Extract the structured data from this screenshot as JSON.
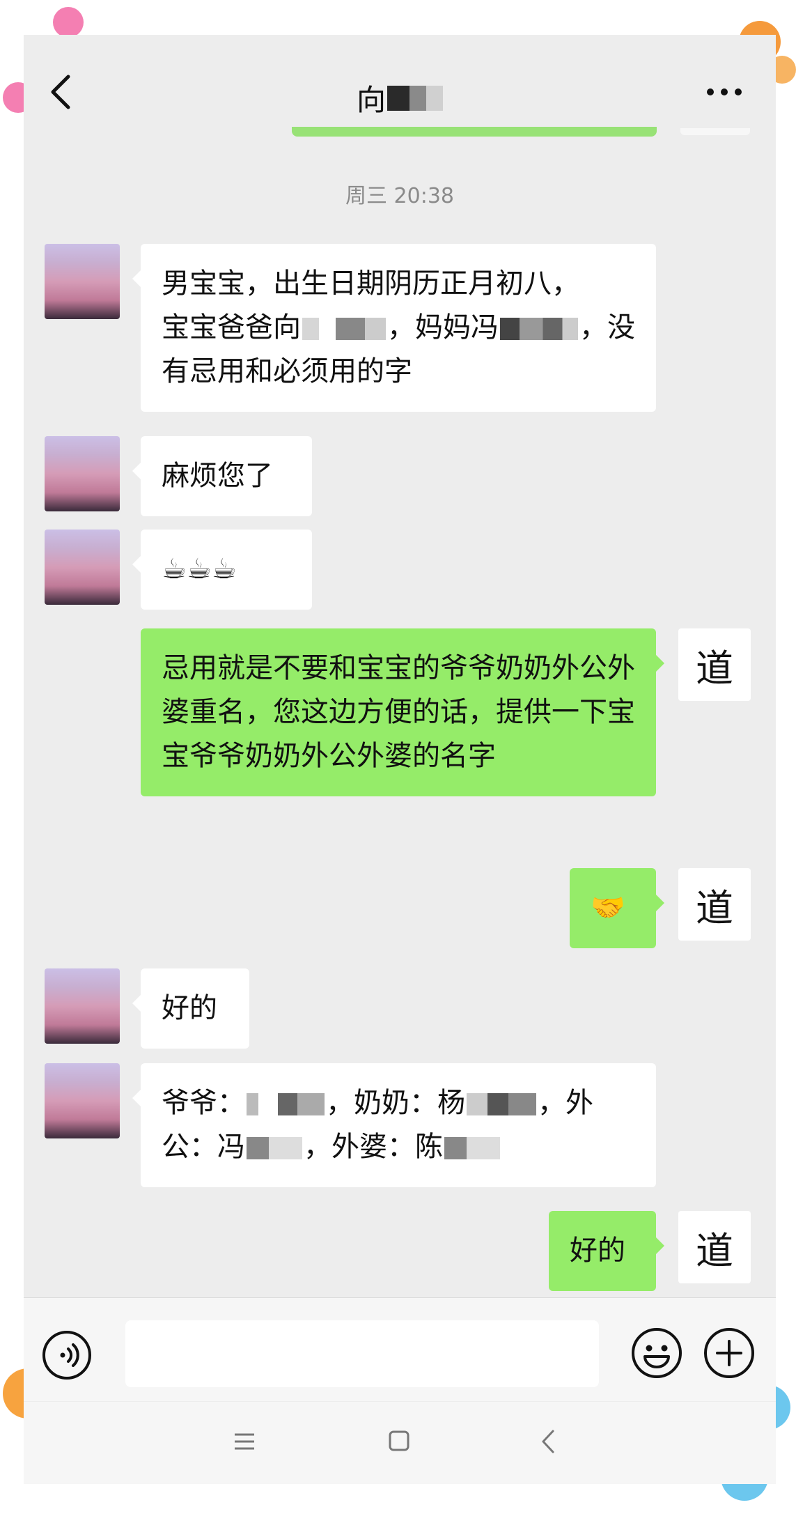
{
  "header": {
    "contact_name": "向"
  },
  "timestamp": "周三 20:38",
  "messages": [
    {
      "side": "in",
      "parts": [
        "男宝宝，出生日期阴历正月初八，",
        "宝宝爸爸向",
        "，妈妈冯",
        "，没有忌用和必须用的字"
      ]
    },
    {
      "side": "in",
      "text": "麻烦您了"
    },
    {
      "side": "in",
      "text": "☕☕☕"
    },
    {
      "side": "out",
      "text": "忌用就是不要和宝宝的爷爷奶奶外公外婆重名，您这边方便的话，提供一下宝宝爷爷奶奶外公外婆的名字"
    },
    {
      "side": "out",
      "text": "🤝"
    },
    {
      "side": "in",
      "text": "好的"
    },
    {
      "side": "in",
      "parts": [
        "爷爷：",
        "，奶奶：杨",
        "，外公：冯",
        "，外婆：陈"
      ]
    },
    {
      "side": "out",
      "text": "好的"
    }
  ],
  "my_avatar_glyph": "道",
  "input": {
    "placeholder": ""
  },
  "icons": {
    "back": "chevron-left-icon",
    "more": "more-dots-icon",
    "voice": "voice-icon",
    "emoji": "emoji-icon",
    "plus": "plus-icon",
    "nav_menu": "menu-icon",
    "nav_home": "home-icon",
    "nav_back": "back-icon"
  },
  "colors": {
    "chat_background": "#ededed",
    "incoming_bubble": "#ffffff",
    "outgoing_bubble": "#95ec69",
    "timestamp_text": "#8a8a8a"
  }
}
